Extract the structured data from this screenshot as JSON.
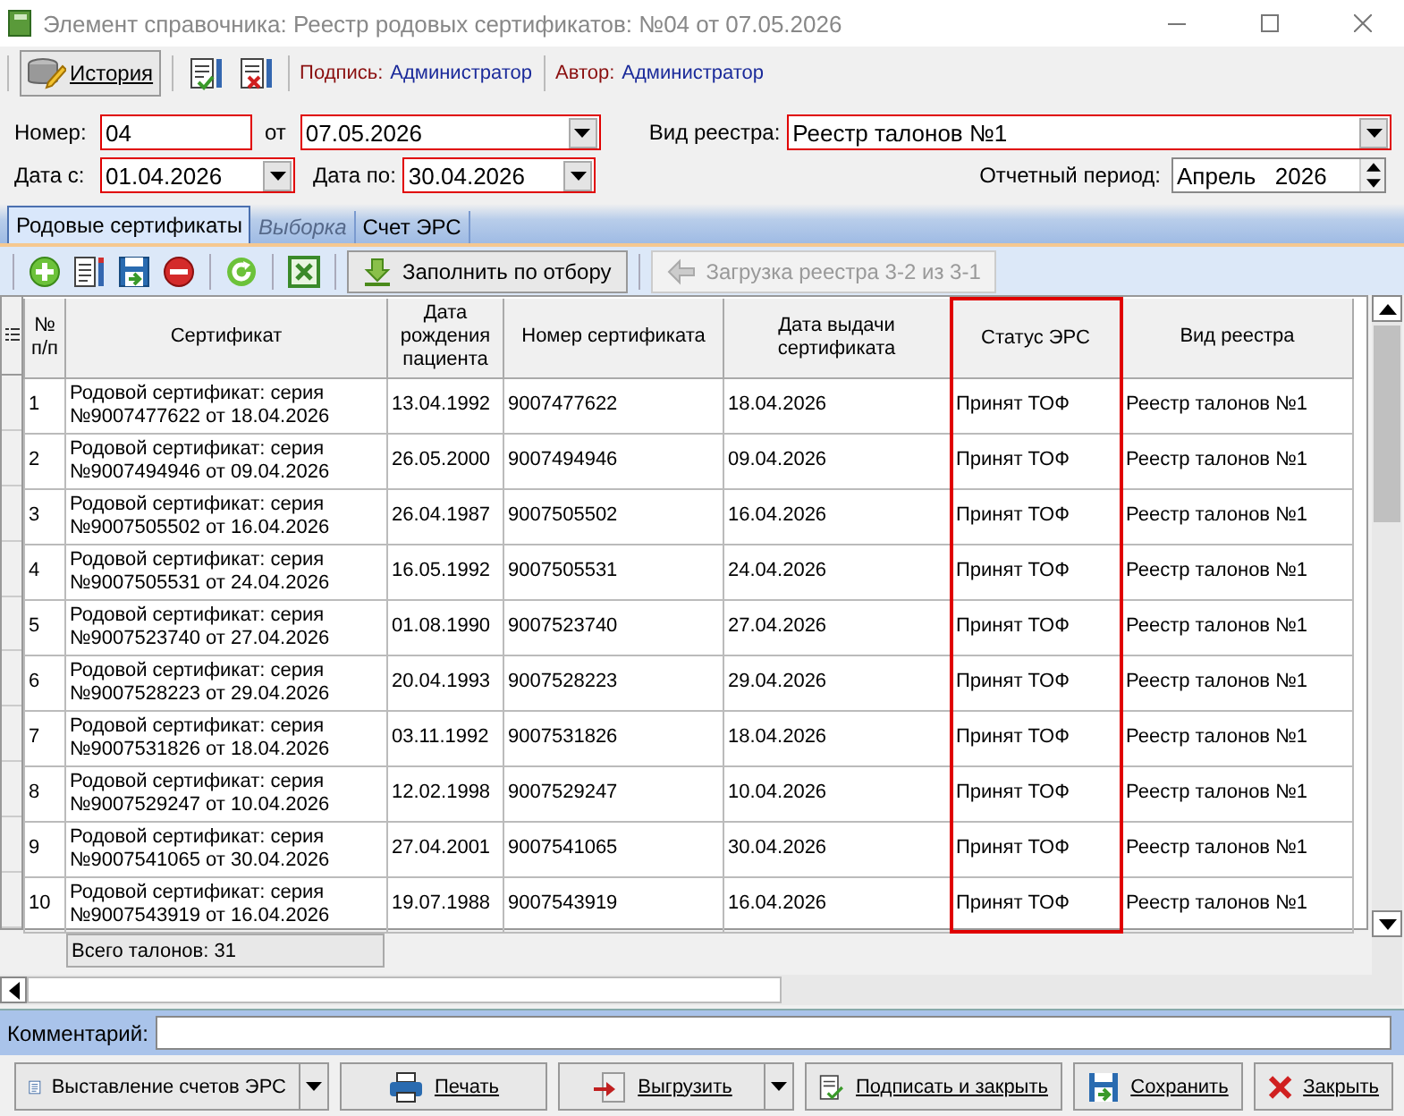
{
  "window": {
    "title": "Элемент справочника: Реестр родовых сертификатов: №04 от 07.05.2026"
  },
  "toolbar": {
    "history_button": "История",
    "signature_label": "Подпись:",
    "signature_value": "Администратор",
    "author_label": "Автор:",
    "author_value": "Администратор"
  },
  "form": {
    "number_label": "Номер:",
    "number": {
      "value": "04",
      "required": true
    },
    "from_label": "от",
    "date": {
      "value": "07.05.2026",
      "required": true
    },
    "registry_type_label": "Вид реестра:",
    "registry_type": {
      "value": "Реестр талонов №1",
      "required": true
    },
    "date_from_label": "Дата с:",
    "date_from": {
      "value": "01.04.2026",
      "required": true
    },
    "date_to_label": "Дата по:",
    "date_to": {
      "value": "30.04.2026",
      "required": true
    },
    "period_label": "Отчетный период:",
    "period": {
      "value": "Апрель   2026",
      "required": false
    }
  },
  "tabs": [
    {
      "label": "Родовые сертификаты",
      "selected": true,
      "disabled": false
    },
    {
      "label": "Выборка",
      "selected": false,
      "disabled": true
    },
    {
      "label": "Счет ЭРС",
      "selected": false,
      "disabled": false
    }
  ],
  "grid_toolbar": {
    "fill_button": {
      "label": "Заполнить по отбору",
      "disabled": false
    },
    "load_button": {
      "label": "Загрузка реестра 3-2 из 3-1",
      "disabled": true
    }
  },
  "table": {
    "columns": [
      {
        "label": "№ п/п",
        "highlighted": false
      },
      {
        "label": "Сертификат",
        "highlighted": false
      },
      {
        "label": "Дата рождения пациента",
        "highlighted": false
      },
      {
        "label": "Номер сертификата",
        "highlighted": false
      },
      {
        "label": "Дата выдачи сертификата",
        "highlighted": false
      },
      {
        "label": "Статус ЭРС",
        "highlighted": true
      },
      {
        "label": "Вид реестра",
        "highlighted": false
      }
    ],
    "rows": [
      [
        "1",
        "Родовой сертификат: серия №9007477622 от 18.04.2026",
        "13.04.1992",
        "9007477622",
        "18.04.2026",
        "Принят ТОФ",
        "Реестр талонов №1"
      ],
      [
        "2",
        "Родовой сертификат: серия №9007494946 от 09.04.2026",
        "26.05.2000",
        "9007494946",
        "09.04.2026",
        "Принят ТОФ",
        "Реестр талонов №1"
      ],
      [
        "3",
        "Родовой сертификат: серия №9007505502 от 16.04.2026",
        "26.04.1987",
        "9007505502",
        "16.04.2026",
        "Принят ТОФ",
        "Реестр талонов №1"
      ],
      [
        "4",
        "Родовой сертификат: серия №9007505531 от 24.04.2026",
        "16.05.1992",
        "9007505531",
        "24.04.2026",
        "Принят ТОФ",
        "Реестр талонов №1"
      ],
      [
        "5",
        "Родовой сертификат: серия №9007523740 от 27.04.2026",
        "01.08.1990",
        "9007523740",
        "27.04.2026",
        "Принят ТОФ",
        "Реестр талонов №1"
      ],
      [
        "6",
        "Родовой сертификат: серия №9007528223 от 29.04.2026",
        "20.04.1993",
        "9007528223",
        "29.04.2026",
        "Принят ТОФ",
        "Реестр талонов №1"
      ],
      [
        "7",
        "Родовой сертификат: серия №9007531826 от 18.04.2026",
        "03.11.1992",
        "9007531826",
        "18.04.2026",
        "Принят ТОФ",
        "Реестр талонов №1"
      ],
      [
        "8",
        "Родовой сертификат: серия №9007529247 от 10.04.2026",
        "12.02.1998",
        "9007529247",
        "10.04.2026",
        "Принят ТОФ",
        "Реестр талонов №1"
      ],
      [
        "9",
        "Родовой сертификат: серия №9007541065 от 30.04.2026",
        "27.04.2001",
        "9007541065",
        "30.04.2026",
        "Принят ТОФ",
        "Реестр талонов №1"
      ],
      [
        "10",
        "Родовой сертификат: серия №9007543919 от 16.04.2026",
        "19.07.1988",
        "9007543919",
        "16.04.2026",
        "Принят ТОФ",
        "Реестр талонов №1"
      ]
    ],
    "total": "Всего талонов: 31"
  },
  "comment": {
    "label": "Комментарий:"
  },
  "buttons": [
    {
      "label": "Выставление счетов ЭРС",
      "has_menu": true
    },
    {
      "label": "Печать",
      "has_menu": false
    },
    {
      "label": "Выгрузить",
      "has_menu": true
    },
    {
      "label": "Подписать и закрыть",
      "has_menu": false
    },
    {
      "label": "Сохранить",
      "has_menu": false
    },
    {
      "label": "Закрыть",
      "has_menu": false
    }
  ]
}
